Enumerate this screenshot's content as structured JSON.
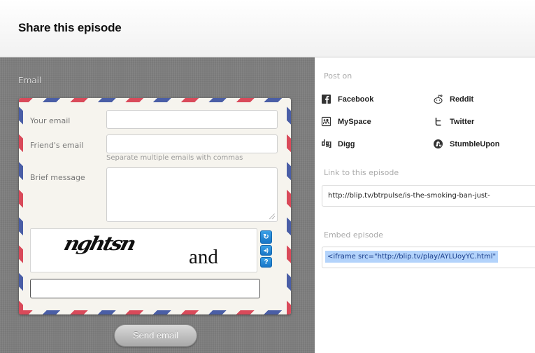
{
  "header": {
    "title": "Share this episode"
  },
  "email_panel": {
    "section_label": "Email",
    "your_email_label": "Your email",
    "friends_email_label": "Friend's email",
    "friends_email_hint": "Separate multiple emails with commas",
    "message_label": "Brief message",
    "captcha": {
      "word1": "nghtsn",
      "word2": "and"
    },
    "send_button": "Send email"
  },
  "share_panel": {
    "post_on_label": "Post on",
    "services": [
      {
        "label": "Facebook",
        "icon": "facebook-icon"
      },
      {
        "label": "Reddit",
        "icon": "reddit-icon"
      },
      {
        "label": "MySpace",
        "icon": "myspace-icon"
      },
      {
        "label": "Twitter",
        "icon": "twitter-icon"
      },
      {
        "label": "Digg",
        "icon": "digg-icon"
      },
      {
        "label": "StumbleUpon",
        "icon": "stumbleupon-icon"
      }
    ],
    "link_label": "Link to this episode",
    "link_value": "http://blip.tv/btrpulse/is-the-smoking-ban-just-",
    "embed_label": "Embed episode",
    "embed_value": "<iframe src=\"http://blip.tv/play/AYLUoyYC.html\" "
  },
  "colors": {
    "left_panel_bg": "#7d7d7d",
    "stripe_red": "#d94a5a",
    "stripe_blue": "#4a5ea6",
    "selection": "#b3d3fb"
  }
}
